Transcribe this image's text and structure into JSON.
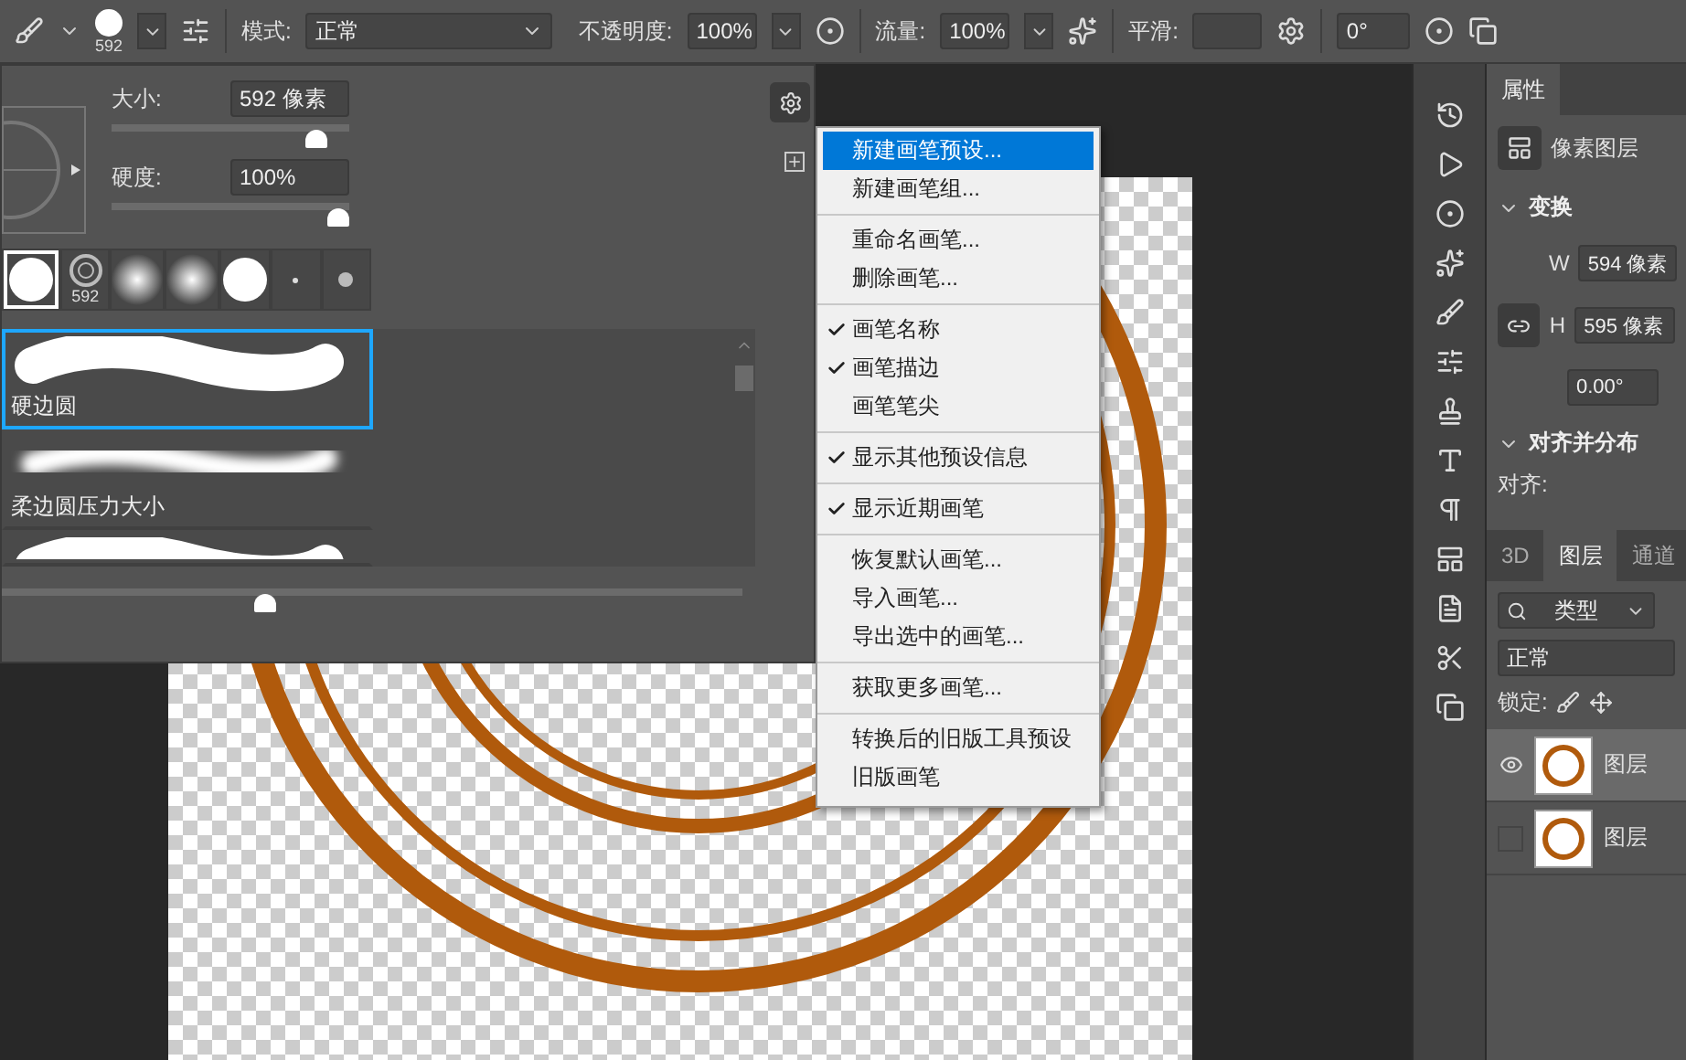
{
  "toolbar": {
    "brush_size": "592",
    "mode_label": "模式:",
    "mode": "正常",
    "opacity_label": "不透明度:",
    "opacity": "100%",
    "flow_label": "流量:",
    "flow": "100%",
    "smoothing_label": "平滑:",
    "angle": "0°"
  },
  "brush_panel": {
    "size_label": "大小:",
    "size_value": "592 像素",
    "size_slider": {
      "level": 0.9
    },
    "hardness_label": "硬度:",
    "hardness_value": "100%",
    "hardness_slider": {
      "level": 1.0
    },
    "recent_brushes": [
      {
        "kind": "hard",
        "selected": true
      },
      {
        "kind": "stamp",
        "label": "592",
        "selected": false
      },
      {
        "kind": "soft",
        "selected": false
      },
      {
        "kind": "soft",
        "selected": false
      },
      {
        "kind": "hard",
        "selected": false
      },
      {
        "kind": "dot",
        "selected": false
      },
      {
        "kind": "small",
        "selected": false
      }
    ],
    "presets": [
      {
        "kind": "hard",
        "name": "硬边圆",
        "selected": true
      },
      {
        "kind": "soft",
        "name": "柔边圆压力大小",
        "selected": false
      },
      {
        "kind": "hard",
        "selected": false
      }
    ],
    "preview_slider": {
      "level": 0.35
    }
  },
  "menu": {
    "sections": [
      {
        "items": [
          {
            "label": "新建画笔预设...",
            "checked": false,
            "selected": true
          },
          {
            "label": "新建画笔组...",
            "checked": false,
            "selected": false
          }
        ]
      },
      {
        "items": [
          {
            "label": "重命名画笔...",
            "checked": false,
            "selected": false
          },
          {
            "label": "删除画笔...",
            "checked": false,
            "selected": false
          }
        ]
      },
      {
        "items": [
          {
            "label": "画笔名称",
            "checked": true,
            "selected": false
          },
          {
            "label": "画笔描边",
            "checked": true,
            "selected": false
          },
          {
            "label": "画笔笔尖",
            "checked": false,
            "selected": false
          }
        ]
      },
      {
        "items": [
          {
            "label": "显示其他预设信息",
            "checked": true,
            "selected": false
          }
        ]
      },
      {
        "items": [
          {
            "label": "显示近期画笔",
            "checked": true,
            "selected": false
          }
        ]
      },
      {
        "items": [
          {
            "label": "恢复默认画笔...",
            "checked": false,
            "selected": false
          },
          {
            "label": "导入画笔...",
            "checked": false,
            "selected": false
          },
          {
            "label": "导出选中的画笔...",
            "checked": false,
            "selected": false
          }
        ]
      },
      {
        "items": [
          {
            "label": "获取更多画笔...",
            "checked": false,
            "selected": false
          }
        ]
      },
      {
        "items": [
          {
            "label": "转换后的旧版工具预设",
            "checked": false,
            "selected": false
          },
          {
            "label": "旧版画笔",
            "checked": false,
            "selected": false
          }
        ]
      }
    ]
  },
  "properties": {
    "tab": "属性",
    "layer_type": "像素图层",
    "transform_title": "变换",
    "w_label": "W",
    "w_value": "594 像素",
    "h_label": "H",
    "h_value": "595 像素",
    "angle_value": "0.00°",
    "align_title": "对齐并分布",
    "align_label": "对齐:"
  },
  "layers_panel": {
    "tabs": [
      {
        "label": "3D",
        "selected": false
      },
      {
        "label": "图层",
        "selected": true
      },
      {
        "label": "通道",
        "selected": false
      }
    ],
    "filter": "类型",
    "blend": "正常",
    "lock_label": "锁定:",
    "layers": [
      {
        "name": "图层",
        "visible": true,
        "selected": true
      },
      {
        "name": "图层",
        "visible": false,
        "selected": false
      }
    ]
  }
}
